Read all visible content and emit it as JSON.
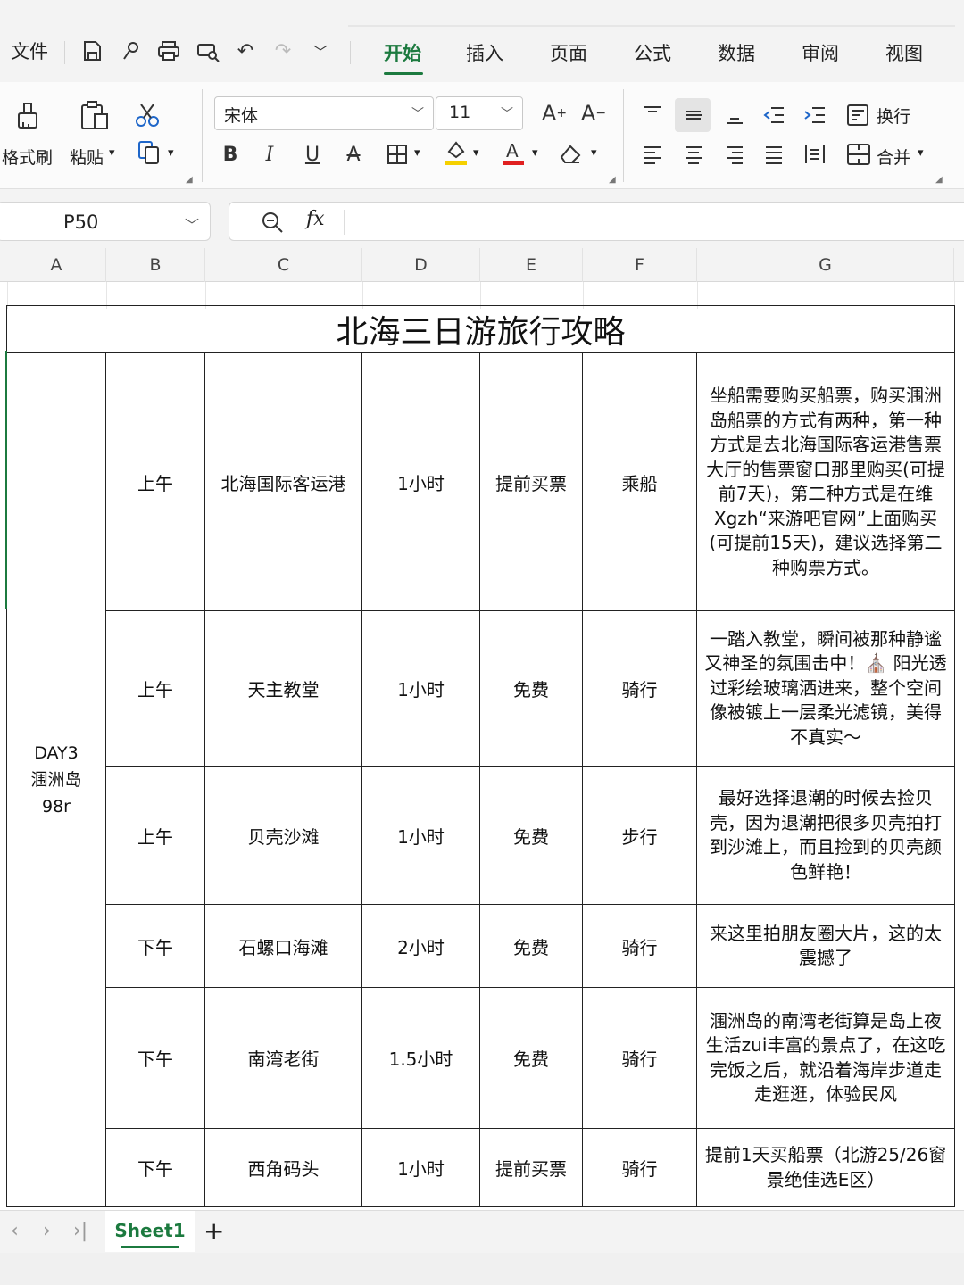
{
  "menubar": {
    "file": "文件",
    "tabs": [
      "开始",
      "插入",
      "页面",
      "公式",
      "数据",
      "审阅",
      "视图"
    ],
    "active_tab": "开始"
  },
  "ribbon": {
    "format_painter": "格式刷",
    "paste": "粘贴",
    "font_name": "宋体",
    "font_size": "11",
    "bold": "B",
    "italic": "I",
    "underline": "U",
    "strike": "A",
    "wrap": "换行",
    "merge": "合并",
    "font_color": "#e02020",
    "highlight_color": "#f5d000"
  },
  "formula_bar": {
    "cell_ref": "P50",
    "fx": "fx",
    "value": ""
  },
  "columns": [
    "A",
    "B",
    "C",
    "D",
    "E",
    "F",
    "G"
  ],
  "table": {
    "title": "北海三日游旅行攻略",
    "day_line1": "DAY3",
    "day_line2": "涠洲岛",
    "day_line3": "98r",
    "rows": [
      {
        "time": "上午",
        "place": "北海国际客运港",
        "duration": "1小时",
        "ticket": "提前买票",
        "transport": "乘船",
        "note": "坐船需要购买船票，购买涠洲岛船票的方式有两种，第一种方式是去北海国际客运港售票大厅的售票窗口那里购买(可提前7天)，第二种方式是在维Xgzh“来游吧官网”上面购买(可提前15天)，建议选择第二种购票方式。"
      },
      {
        "time": "上午",
        "place": "天主教堂",
        "duration": "1小时",
        "ticket": "免费",
        "transport": "骑行",
        "note": "一踏入教堂，瞬间被那种静谧又神圣的氛围击中！⛪ 阳光透过彩绘玻璃洒进来，整个空间像被镀上一层柔光滤镜，美得不真实～"
      },
      {
        "time": "上午",
        "place": "贝壳沙滩",
        "duration": "1小时",
        "ticket": "免费",
        "transport": "步行",
        "note": "最好选择退潮的时候去捡贝壳，因为退潮把很多贝壳拍打到沙滩上，而且捡到的贝壳颜色鲜艳！"
      },
      {
        "time": "下午",
        "place": "石螺口海滩",
        "duration": "2小时",
        "ticket": "免费",
        "transport": "骑行",
        "note": "来这里拍朋友圈大片，这的太震撼了"
      },
      {
        "time": "下午",
        "place": "南湾老街",
        "duration": "1.5小时",
        "ticket": "免费",
        "transport": "骑行",
        "note": "涠洲岛的南湾老街算是岛上夜生活zui丰富的景点了，在这吃完饭之后，就沿着海岸步道走走逛逛，体验民风"
      },
      {
        "time": "下午",
        "place": "西角码头",
        "duration": "1小时",
        "ticket": "提前买票",
        "transport": "骑行",
        "note": "提前1天买船票（北游25/26窗景绝佳选E区）"
      }
    ]
  },
  "sheet_tabs": {
    "active": "Sheet1",
    "add": "+"
  },
  "accent_color": "#1c7a3f"
}
